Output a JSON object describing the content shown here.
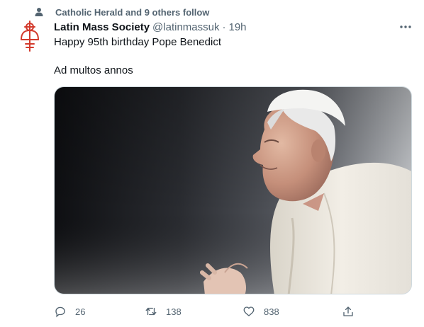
{
  "social_context": {
    "text": "Catholic Herald and 9 others follow",
    "icon": "person-icon"
  },
  "tweet": {
    "author_name": "Latin Mass Society",
    "author_handle": "@latinmassuk",
    "separator": "·",
    "timestamp": "19h",
    "text_lines": [
      "Happy 95th birthday Pope Benedict",
      "Ad multos annos"
    ],
    "avatar_icon": "latin-mass-society-logo",
    "media": {
      "kind": "photo"
    }
  },
  "actions": {
    "reply_count": "26",
    "retweet_count": "138",
    "like_count": "838"
  },
  "colors": {
    "text_primary": "#0f1419",
    "text_secondary": "#536471",
    "logo_red": "#d33a2c",
    "border": "#cfd9de"
  }
}
